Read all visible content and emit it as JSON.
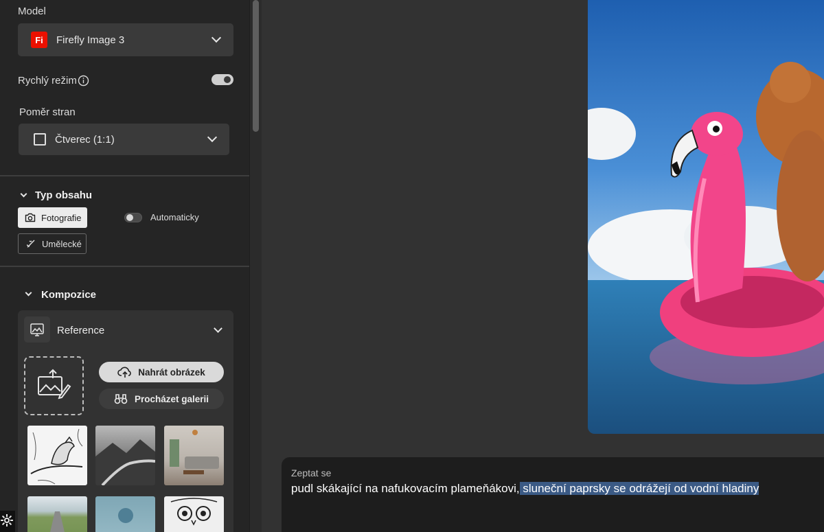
{
  "model": {
    "label": "Model",
    "badge": "Fi",
    "selected": "Firefly Image 3"
  },
  "fast_mode": {
    "label": "Rychlý režim",
    "enabled": true
  },
  "aspect": {
    "label": "Poměr stran",
    "selected": "Čtverec (1:1)"
  },
  "content_type": {
    "title": "Typ obsahu",
    "photo": "Fotografie",
    "art": "Umělecké",
    "auto": "Automaticky",
    "auto_enabled": false,
    "selected": "Fotografie"
  },
  "composition": {
    "title": "Kompozice",
    "reference_label": "Reference",
    "upload": "Nahrát obrázek",
    "browse": "Procházet galerii"
  },
  "prompt": {
    "label": "Zeptat se",
    "text_plain": "pudl skákající na nafukovacím plameňákovi,",
    "text_selected": " sluneční paprsky se odrážejí od vodní hladiny"
  },
  "colors": {
    "accent_firefly": "#eb1000",
    "selection": "#3b5a85",
    "sidebar_bg": "#252525",
    "canvas_bg": "#323232"
  }
}
